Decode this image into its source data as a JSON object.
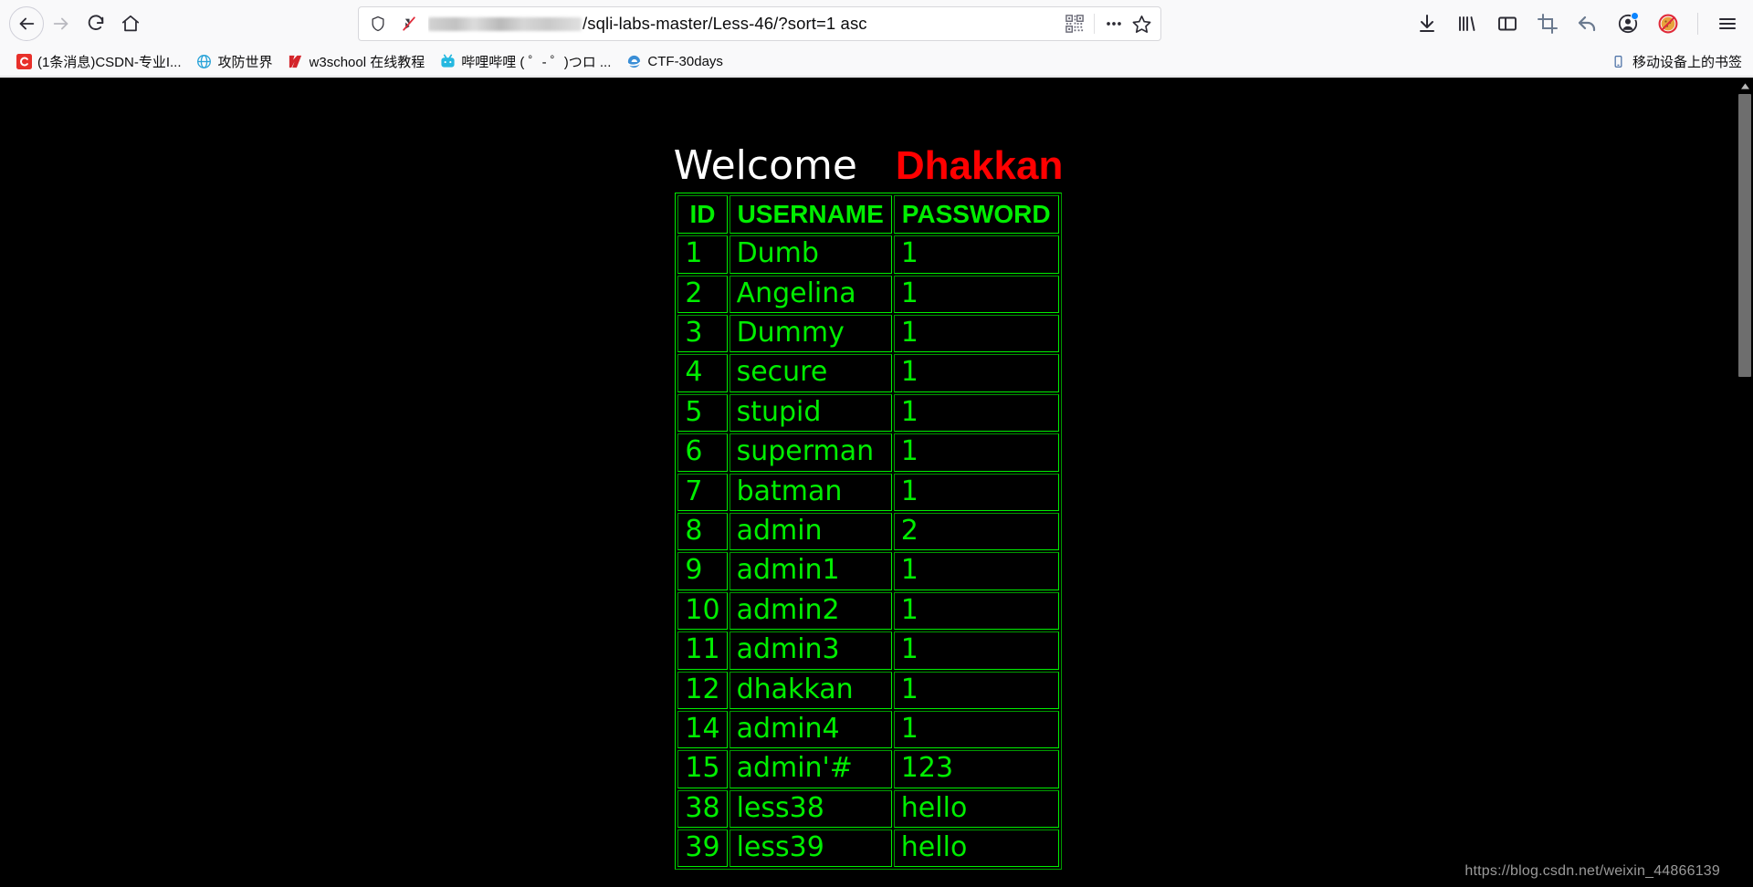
{
  "browser": {
    "nav": {
      "back_label": "Back",
      "forward_label": "Forward",
      "reload_label": "Reload",
      "home_label": "Home"
    },
    "urlbar": {
      "redacted_prefix": "",
      "url_text": "/sqli-labs-master/Less-46/?sort=1 asc",
      "shield_title": "Enhanced Tracking Protection",
      "protection_title": "Protection disabled",
      "qr_title": "QR code",
      "more_title": "Page actions",
      "bookmark_title": "Bookmark this page"
    },
    "toolbar_right": [
      {
        "name": "downloads-icon",
        "title": "Downloads"
      },
      {
        "name": "library-icon",
        "title": "Library"
      },
      {
        "name": "sidebar-icon",
        "title": "Sidebars"
      },
      {
        "name": "screenshot-icon",
        "title": "Take a screenshot"
      },
      {
        "name": "undo-icon",
        "title": "Undo"
      },
      {
        "name": "account-icon",
        "title": "Account"
      },
      {
        "name": "no-cookie-icon",
        "title": "Block cookies"
      },
      {
        "name": "menu-icon",
        "title": "Open application menu"
      }
    ],
    "bookmarks": {
      "items": [
        {
          "label": "(1条消息)CSDN-专业I...",
          "icon": "csdn-icon"
        },
        {
          "label": "攻防世界",
          "icon": "globe-icon"
        },
        {
          "label": "w3school 在线教程",
          "icon": "w3school-icon"
        },
        {
          "label": "哔哩哔哩 ( ゜- ゜)つロ ...",
          "icon": "bilibili-icon"
        },
        {
          "label": "CTF-30days",
          "icon": "ie-icon"
        }
      ],
      "mobile_label": "移动设备上的书签",
      "mobile_icon": "mobile-icon"
    }
  },
  "page": {
    "heading": {
      "welcome": "Welcome",
      "name": "Dhakkan"
    },
    "table": {
      "headers": [
        "ID",
        "USERNAME",
        "PASSWORD"
      ],
      "rows": [
        {
          "id": "1",
          "username": "Dumb",
          "password": "1"
        },
        {
          "id": "2",
          "username": "Angelina",
          "password": "1"
        },
        {
          "id": "3",
          "username": "Dummy",
          "password": "1"
        },
        {
          "id": "4",
          "username": "secure",
          "password": "1"
        },
        {
          "id": "5",
          "username": "stupid",
          "password": "1"
        },
        {
          "id": "6",
          "username": "superman",
          "password": "1"
        },
        {
          "id": "7",
          "username": "batman",
          "password": "1"
        },
        {
          "id": "8",
          "username": "admin",
          "password": "2"
        },
        {
          "id": "9",
          "username": "admin1",
          "password": "1"
        },
        {
          "id": "10",
          "username": "admin2",
          "password": "1"
        },
        {
          "id": "11",
          "username": "admin3",
          "password": "1"
        },
        {
          "id": "12",
          "username": "dhakkan",
          "password": "1"
        },
        {
          "id": "14",
          "username": "admin4",
          "password": "1"
        },
        {
          "id": "15",
          "username": "admin'#",
          "password": "123"
        },
        {
          "id": "38",
          "username": "less38",
          "password": "hello"
        },
        {
          "id": "39",
          "username": "less39",
          "password": "hello"
        }
      ]
    },
    "watermark": "https://blog.csdn.net/weixin_44866139",
    "colors": {
      "background": "#000000",
      "table_text": "#00ee00",
      "welcome_text": "#ffffff",
      "name_text": "#ff0000"
    }
  }
}
